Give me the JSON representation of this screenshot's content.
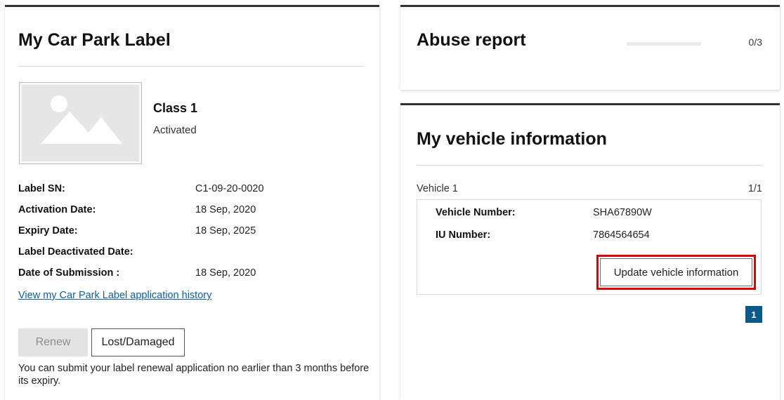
{
  "car_park_label": {
    "title": "My Car Park Label",
    "class_name": "Class 1",
    "status": "Activated",
    "fields": [
      {
        "label": "Label SN:",
        "value": "C1-09-20-0020"
      },
      {
        "label": "Activation Date:",
        "value": "18 Sep, 2020"
      },
      {
        "label": "Expiry Date:",
        "value": "18 Sep, 2025"
      },
      {
        "label": "Label Deactivated Date:",
        "value": ""
      },
      {
        "label": "Date of Submission :",
        "value": "18 Sep, 2020"
      }
    ],
    "history_link": "View my Car Park Label application history",
    "renew_button": "Renew",
    "lost_button": "Lost/Damaged",
    "renew_note": "You can submit your label renewal application no earlier than 3 months before its expiry.",
    "thumbnail_icon": "image-placeholder-icon"
  },
  "abuse_report": {
    "title": "Abuse report",
    "count": "0/3",
    "progress_fraction": 0
  },
  "vehicle_info": {
    "title": "My vehicle information",
    "vehicle_label": "Vehicle 1",
    "vehicle_page": "1/1",
    "vehicle_number_label": "Vehicle Number:",
    "vehicle_number": "SHA67890W",
    "iu_number_label": "IU Number:",
    "iu_number": "7864564654",
    "update_button": "Update vehicle information",
    "pagination_current": "1"
  },
  "colors": {
    "link": "#0b5fa8",
    "highlight": "#e00000",
    "pagination": "#0b5a8c",
    "card_top_border": "#333333"
  }
}
